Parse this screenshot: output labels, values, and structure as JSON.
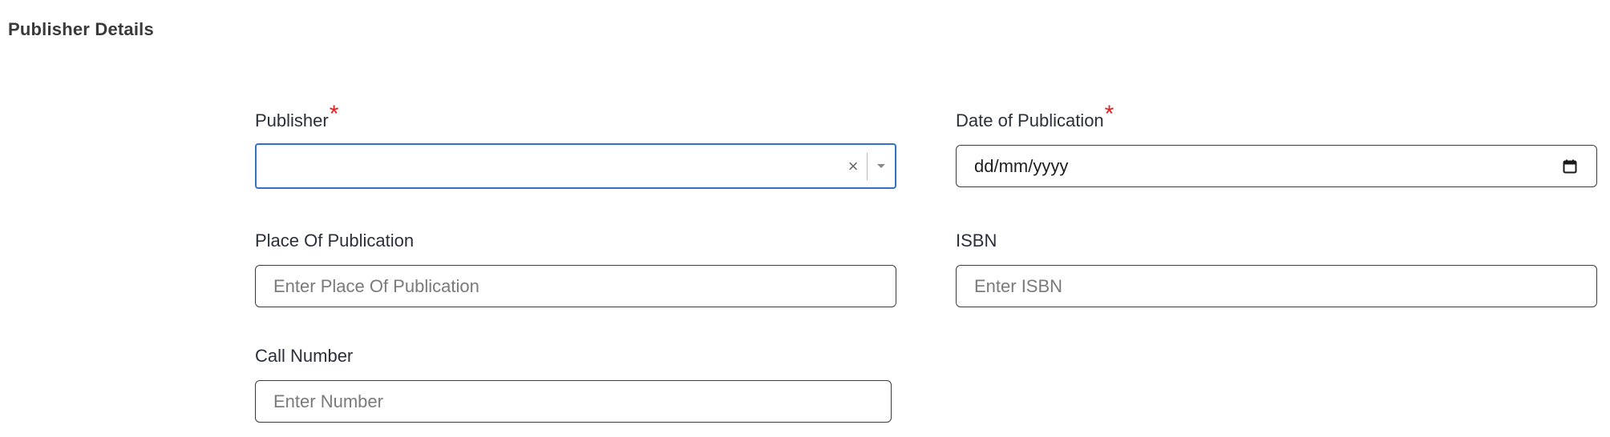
{
  "section": {
    "title": "Publisher Details"
  },
  "fields": {
    "publisher": {
      "label": "Publisher",
      "required_mark": "*",
      "value": "",
      "clear_icon": "×"
    },
    "date_of_publication": {
      "label": "Date of Publication",
      "required_mark": "*",
      "value": "dd/mm/yyyy"
    },
    "place_of_publication": {
      "label": "Place Of Publication",
      "placeholder": "Enter Place Of Publication"
    },
    "isbn": {
      "label": "ISBN",
      "placeholder": "Enter ISBN"
    },
    "call_number": {
      "label": "Call Number",
      "placeholder": "Enter Number"
    }
  },
  "icons": {
    "clear": "clear-icon",
    "dropdown": "chevron-down-icon",
    "calendar": "calendar-icon"
  },
  "colors": {
    "required": "#e02020",
    "focus_border": "#2f74c0",
    "border": "#3b3b3b"
  }
}
